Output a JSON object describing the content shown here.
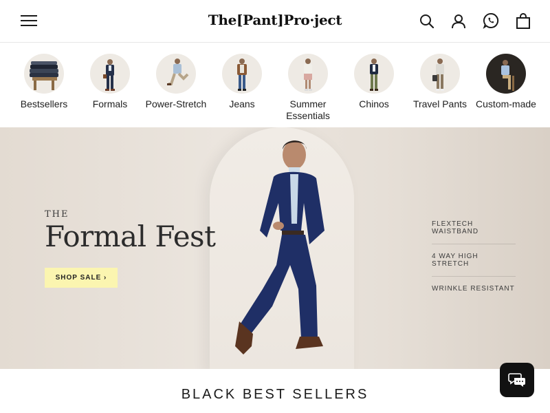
{
  "header": {
    "logo_text": "The[Pant]Pro·ject",
    "icons": [
      "menu-icon",
      "search-icon",
      "account-icon",
      "whatsapp-icon",
      "bag-icon"
    ]
  },
  "categories": [
    {
      "label": "Bestsellers",
      "icon": "folded-pants-stack"
    },
    {
      "label": "Formals",
      "icon": "model-formal"
    },
    {
      "label": "Power-Stretch",
      "icon": "model-stretch"
    },
    {
      "label": "Jeans",
      "icon": "model-jeans"
    },
    {
      "label": "Summer Essentials",
      "icon": "model-summer"
    },
    {
      "label": "Chinos",
      "icon": "model-chinos"
    },
    {
      "label": "Travel Pants",
      "icon": "model-travel"
    },
    {
      "label": "Custom-made",
      "icon": "model-custom"
    }
  ],
  "hero": {
    "eyebrow": "THE",
    "title": "Formal Fest",
    "cta_label": "SHOP SALE ›",
    "cta_color": "#fbf5b0",
    "features": [
      "FLEXTECH WAISTBAND",
      "4 WAY HIGH STRETCH",
      "WRINKLE RESISTANT"
    ]
  },
  "section": {
    "title": "BLACK BEST SELLERS"
  },
  "chat": {
    "icon": "chat-bubbles-icon"
  }
}
